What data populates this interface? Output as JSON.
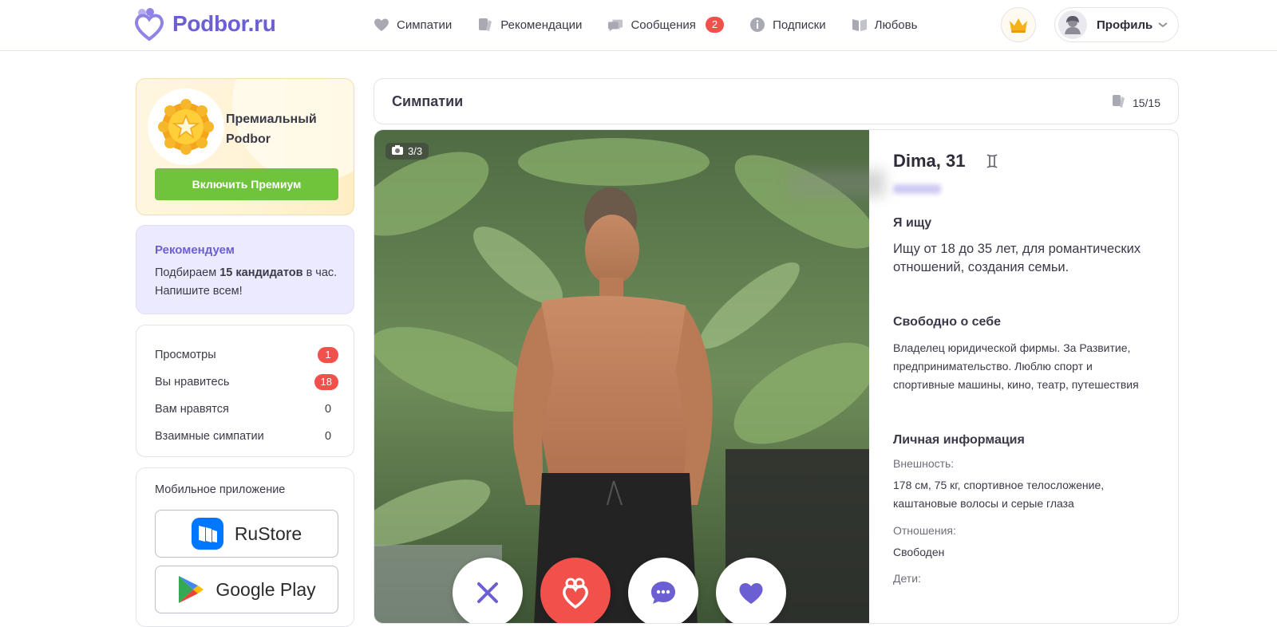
{
  "header": {
    "logo_text": "Podbor.ru",
    "nav": [
      {
        "label": "Симпатии",
        "icon": "heart-icon"
      },
      {
        "label": "Рекомендации",
        "icon": "cards-icon"
      },
      {
        "label": "Сообщения",
        "icon": "chat-icon",
        "badge": "2"
      },
      {
        "label": "Подписки",
        "icon": "info-icon"
      },
      {
        "label": "Любовь",
        "icon": "book-icon"
      }
    ],
    "profile_label": "Профиль"
  },
  "sidebar": {
    "premium": {
      "title": "Премиальный Podbor",
      "button": "Включить Премиум"
    },
    "recommend": {
      "title": "Рекомендуем",
      "text_before": "Подбираем ",
      "text_bold": "15 кандидатов",
      "text_after": " в час. Напишите всем!"
    },
    "stats": [
      {
        "label": "Просмотры",
        "value": "1",
        "badge": true
      },
      {
        "label": "Вы нравитесь",
        "value": "18",
        "badge": true
      },
      {
        "label": "Вам нравятся",
        "value": "0",
        "badge": false
      },
      {
        "label": "Взаимные симпатии",
        "value": "0",
        "badge": false
      }
    ],
    "mobile": {
      "title": "Мобильное приложение",
      "stores": [
        "RuStore",
        "Google Play"
      ]
    }
  },
  "main": {
    "title": "Симпатии",
    "counter": "15/15",
    "photo_counter": "3/3",
    "profile": {
      "name": "Dima, 31",
      "looking_title": "Я ищу",
      "looking_text": "Ищу от 18 до 35 лет, для романтических отношений, создания семьи.",
      "about_title": "Свободно о себе",
      "about_text": "Владелец юридической фирмы. За Развитие, предпринимательство. Люблю спорт и спортивные машины, кино, театр, путешествия",
      "personal_title": "Личная информация",
      "appearance_label": "Внешность:",
      "appearance_value": "178 см, 75 кг, спортивное телосложение, каштановые волосы и серые глаза",
      "relations_label": "Отношения:",
      "relations_value": "Свободен",
      "kids_label": "Дети:"
    }
  },
  "colors": {
    "brand": "#6b5fd3",
    "badge": "#f2504b",
    "premium_button": "#6fc43c",
    "recommend_bg": "#eceaff"
  }
}
